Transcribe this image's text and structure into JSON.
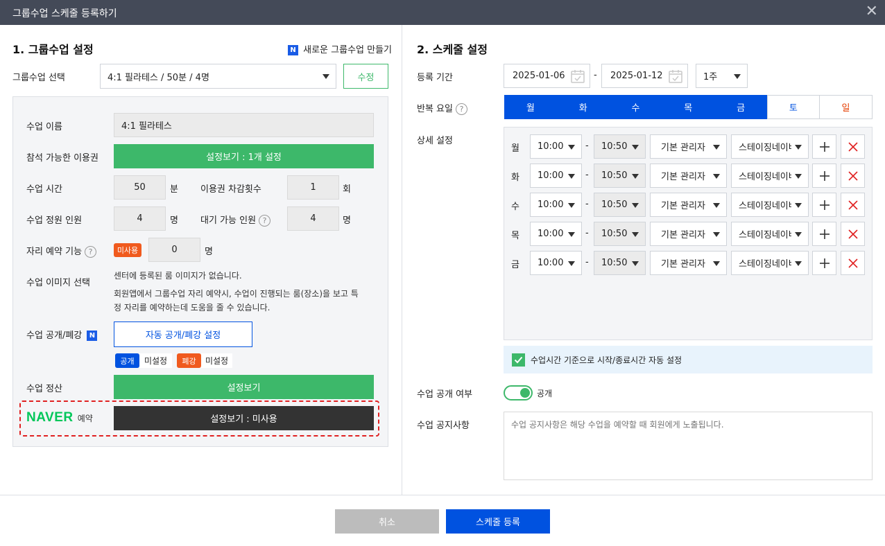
{
  "window": {
    "title": "그룹수업 스케줄 등록하기"
  },
  "left": {
    "section_title": "1. 그룹수업 설정",
    "new_group_link": "새로운 그룹수업 만들기",
    "n_badge": "N",
    "group_select_label": "그룹수업 선택",
    "group_select_value": "4:1 필라테스 / 50분 / 4명",
    "edit_button": "수정",
    "class_name_label": "수업 이름",
    "class_name_value": "4:1 필라테스",
    "ticket_label": "참석 가능한 이용권",
    "ticket_button": "설정보기 : 1개 설정",
    "duration_label": "수업 시간",
    "duration_value": "50",
    "duration_unit": "분",
    "deduct_label": "이용권 차감횟수",
    "deduct_value": "1",
    "deduct_unit": "회",
    "capacity_label": "수업 정원 인원",
    "capacity_value": "4",
    "capacity_unit": "명",
    "waitlist_label": "대기 가능 인원",
    "waitlist_value": "4",
    "waitlist_unit": "명",
    "seat_label": "자리 예약 기능",
    "seat_badge": "미사용",
    "seat_value": "0",
    "seat_unit": "명",
    "image_label": "수업 이미지 선택",
    "image_text1": "센터에 등록된 룸 이미지가 없습니다.",
    "image_text2a": "회원앱에서 그룹수업 자리 예약시, 수업이 진행되는 룸(장소)을 보고 특",
    "image_text2b": "정 자리를 예약하는데 도움을 줄 수 있습니다.",
    "publish_label": "수업 공개/폐강",
    "publish_button": "자동 공개/폐강 설정",
    "open_badge": "공개",
    "open_status": "미설정",
    "close_badge": "폐강",
    "close_status": "미설정",
    "settle_label": "수업 정산",
    "settle_button": "설정보기",
    "naver_logo": "NAVER",
    "naver_suffix": "예약",
    "naver_button": "설정보기 : 미사용"
  },
  "right": {
    "section_title": "2. 스케줄 설정",
    "period_label": "등록 기간",
    "start_date": "2025-01-06",
    "end_date": "2025-01-12",
    "date_sep": "-",
    "period_select": "1주",
    "repeat_label": "반복 요일",
    "days": [
      {
        "label": "월",
        "selected": true
      },
      {
        "label": "화",
        "selected": true
      },
      {
        "label": "수",
        "selected": true
      },
      {
        "label": "목",
        "selected": true
      },
      {
        "label": "금",
        "selected": true
      },
      {
        "label": "토",
        "selected": false
      },
      {
        "label": "일",
        "selected": false
      }
    ],
    "detail_label": "상세 설정",
    "rows": [
      {
        "day": "월",
        "start": "10:00",
        "sep": "-",
        "end": "10:50",
        "staff": "기본 관리자",
        "room": "스테이징네이버"
      },
      {
        "day": "화",
        "start": "10:00",
        "sep": "-",
        "end": "10:50",
        "staff": "기본 관리자",
        "room": "스테이징네이버"
      },
      {
        "day": "수",
        "start": "10:00",
        "sep": "-",
        "end": "10:50",
        "staff": "기본 관리자",
        "room": "스테이징네이버"
      },
      {
        "day": "목",
        "start": "10:00",
        "sep": "-",
        "end": "10:50",
        "staff": "기본 관리자",
        "room": "스테이징네이버"
      },
      {
        "day": "금",
        "start": "10:00",
        "sep": "-",
        "end": "10:50",
        "staff": "기본 관리자",
        "room": "스테이징네이버"
      }
    ],
    "auto_time_label": "수업시간 기준으로 시작/종료시간 자동 설정",
    "public_label": "수업 공개 여부",
    "public_toggle_label": "공개",
    "notice_label": "수업 공지사항",
    "notice_placeholder": "수업 공지사항은 해당 수업을 예약할 때 회원에게 노출됩니다."
  },
  "footer": {
    "cancel": "취소",
    "submit": "스케줄 등록"
  },
  "colors": {
    "header": "#444a58",
    "blue": "#0052e0",
    "green": "#3db86a",
    "dark": "#333333",
    "orange": "#f05a1e",
    "red": "#e02020",
    "sunday": "#e53d00",
    "saturday": "#0052e0"
  }
}
